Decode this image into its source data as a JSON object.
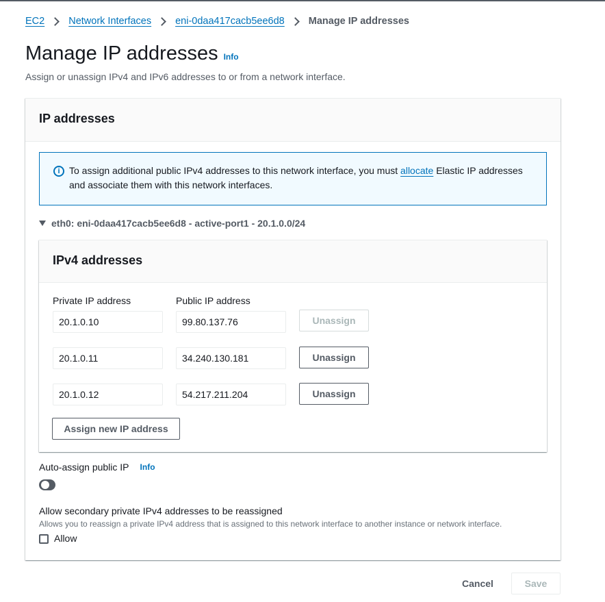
{
  "breadcrumb": {
    "items": [
      "EC2",
      "Network Interfaces",
      "eni-0daa417cacb5ee6d8"
    ],
    "current": "Manage IP addresses"
  },
  "page": {
    "title": "Manage IP addresses",
    "info": "Info",
    "description": "Assign or unassign IPv4 and IPv6 addresses to or from a network interface."
  },
  "panel": {
    "title": "IP addresses",
    "alert": {
      "text_before": "To assign additional public IPv4 addresses to this network interface, you must ",
      "link": "allocate",
      "text_after": " Elastic IP addresses and associate them with this network interfaces."
    },
    "interface_label": "eth0: eni-0daa417cacb5ee6d8 - active-port1 - 20.1.0.0/24"
  },
  "ipv4": {
    "title": "IPv4 addresses",
    "private_header": "Private IP address",
    "public_header": "Public IP address",
    "rows": [
      {
        "private": "20.1.0.10",
        "public": "99.80.137.76",
        "action": "Unassign",
        "disabled": true
      },
      {
        "private": "20.1.0.11",
        "public": "34.240.130.181",
        "action": "Unassign",
        "disabled": false
      },
      {
        "private": "20.1.0.12",
        "public": "54.217.211.204",
        "action": "Unassign",
        "disabled": false
      }
    ],
    "assign_button": "Assign new IP address"
  },
  "auto_assign": {
    "label": "Auto-assign public IP",
    "info": "Info"
  },
  "reassign": {
    "title": "Allow secondary private IPv4 addresses to be reassigned",
    "description": "Allows you to reassign a private IPv4 address that is assigned to this network interface to another instance or network interface.",
    "checkbox_label": "Allow"
  },
  "footer": {
    "cancel": "Cancel",
    "save": "Save"
  },
  "colors": {
    "link": "#0073bb",
    "text": "#16191f",
    "secondary_text": "#545b64",
    "alert_bg": "#f1faff",
    "disabled": "#aab7b8"
  }
}
